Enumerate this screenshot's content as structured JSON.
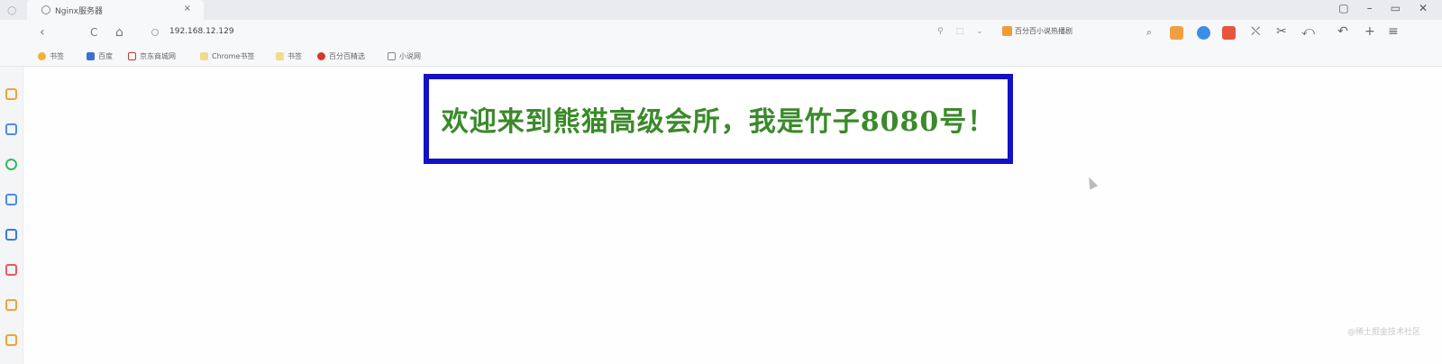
{
  "browser": {
    "tab": {
      "title": "Nginx服务器",
      "close": "×"
    },
    "window_controls": [
      "▢",
      "–",
      "▭",
      "✕"
    ],
    "window_left_glyph": "○",
    "nav": {
      "back": "‹",
      "refresh": "C",
      "home": "⌂"
    },
    "address": {
      "url": "192.168.12.129"
    },
    "address_tail": [
      "⚲",
      "⬚",
      "⌄"
    ],
    "search": {
      "engine_label": "百分百小说热播剧"
    },
    "tools": [
      "⌕",
      "⛌",
      "✂",
      "⤺",
      "↶",
      "+",
      "≡"
    ]
  },
  "bookmarks": [
    {
      "label": "书签",
      "color": "#f2b134"
    },
    {
      "label": "百度",
      "color": "#3c6fd6"
    },
    {
      "label": "京东商城网",
      "color": "#c0392b"
    },
    {
      "label": "Chrome书签",
      "color": "#e6c86a"
    },
    {
      "label": "书签",
      "color": "#e6c86a"
    },
    {
      "label": "百分百精选",
      "color": "#d23b2f"
    },
    {
      "label": "小说网",
      "color": "#888888"
    }
  ],
  "sidebar_colors": [
    "#f0a23a",
    "#4a8df0",
    "#37b862",
    "#4a8df0",
    "#3a7be0",
    "#e85a5a",
    "#f0a23a",
    "#f0a23a"
  ],
  "page": {
    "welcome_text": "欢迎来到熊猫高级会所，我是竹子8080号！",
    "watermark": "@稀土掘金技术社区"
  },
  "colors": {
    "box_border": "#1410c4",
    "text": "#3a8a2a"
  }
}
